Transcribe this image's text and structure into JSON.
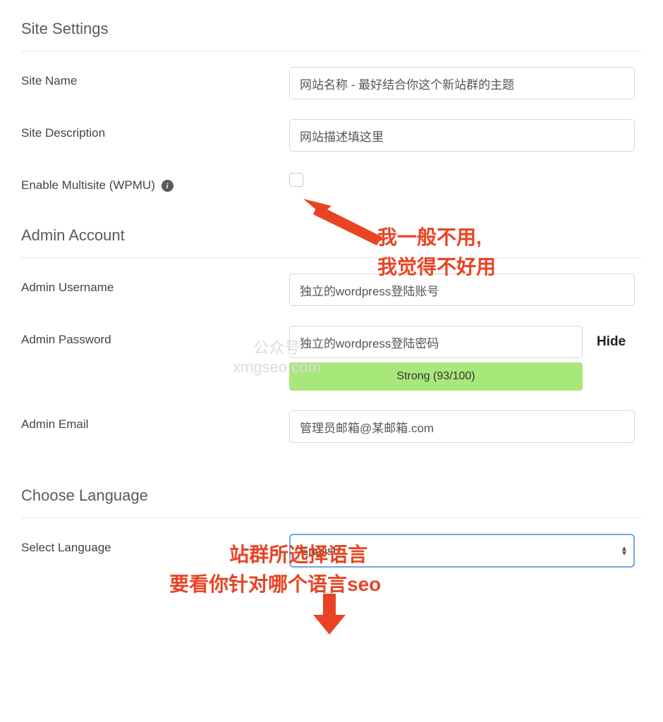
{
  "sections": {
    "site_settings": "Site Settings",
    "admin_account": "Admin Account",
    "choose_language": "Choose Language"
  },
  "labels": {
    "site_name": "Site Name",
    "site_description": "Site Description",
    "enable_multisite": "Enable Multisite (WPMU)",
    "admin_username": "Admin Username",
    "admin_password": "Admin Password",
    "admin_email": "Admin Email",
    "select_language": "Select Language"
  },
  "values": {
    "site_name": "网站名称 - 最好结合你这个新站群的主题",
    "site_description": "网站描述填这里",
    "admin_username": "独立的wordpress登陆账号",
    "admin_password": "独立的wordpress登陆密码",
    "admin_email": "管理员邮箱@某邮箱.com",
    "language": "English"
  },
  "password": {
    "hide_label": "Hide",
    "strength_text": "Strong (93/100)"
  },
  "annotations": {
    "multisite_line1": "我一般不用,",
    "multisite_line2": "我觉得不好用",
    "language_line1": "站群所选择语言",
    "language_line2": "要看你针对哪个语言seo"
  },
  "watermark": {
    "line1": "公众号",
    "line2": "xmgseo.com"
  }
}
